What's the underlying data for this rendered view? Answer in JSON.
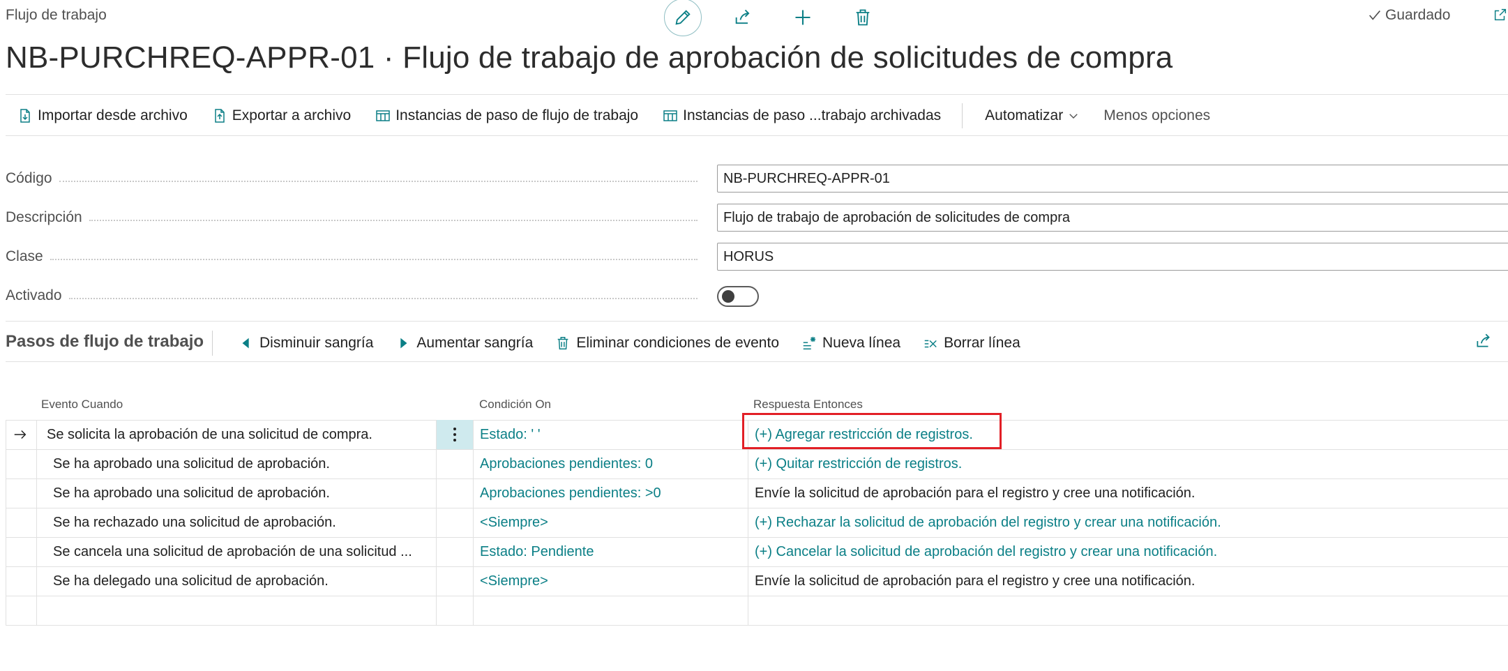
{
  "header": {
    "breadcrumb": "Flujo de trabajo",
    "saved_label": "Guardado",
    "title": "NB-PURCHREQ-APPR-01 · Flujo de trabajo de aprobación de solicitudes de compra",
    "icons": [
      "edit-icon",
      "share-icon",
      "add-icon",
      "delete-icon"
    ]
  },
  "actions": {
    "import": "Importar desde archivo",
    "export": "Exportar a archivo",
    "step_instances": "Instancias de paso de flujo de trabajo",
    "archived_instances": "Instancias de paso ...trabajo archivadas",
    "automate": "Automatizar",
    "fewer_options": "Menos opciones"
  },
  "fields": {
    "code_label": "Código",
    "code_value": "NB-PURCHREQ-APPR-01",
    "description_label": "Descripción",
    "description_value": "Flujo de trabajo de aprobación de solicitudes de compra",
    "class_label": "Clase",
    "class_value": "HORUS",
    "enabled_label": "Activado",
    "enabled": false
  },
  "steps": {
    "title": "Pasos de flujo de trabajo",
    "decrease_indent": "Disminuir sangría",
    "increase_indent": "Aumentar sangría",
    "delete_conditions": "Eliminar condiciones de evento",
    "new_line": "Nueva línea",
    "delete_line": "Borrar línea",
    "columns": {
      "event": "Evento Cuando",
      "condition": "Condición On",
      "response": "Respuesta Entonces"
    },
    "rows": [
      {
        "event": "Se solicita la aprobación de una solicitud de compra.",
        "condition": "Estado: ' '",
        "response": "(+) Agregar restricción de registros.",
        "response_link": true
      },
      {
        "event": "Se ha aprobado una solicitud de aprobación.",
        "condition": "Aprobaciones pendientes: 0",
        "response": "(+) Quitar restricción de registros.",
        "response_link": true
      },
      {
        "event": "Se ha aprobado una solicitud de aprobación.",
        "condition": "Aprobaciones pendientes: >0",
        "response": "Envíe la solicitud de aprobación para el registro y cree una notificación.",
        "response_link": false
      },
      {
        "event": "Se ha rechazado una solicitud de aprobación.",
        "condition": "<Siempre>",
        "response": "(+) Rechazar la solicitud de aprobación del registro y crear una notificación.",
        "response_link": true
      },
      {
        "event": "Se cancela una solicitud de aprobación de una solicitud ...",
        "condition": "Estado: Pendiente",
        "response": "(+) Cancelar la solicitud de aprobación del registro y crear una notificación.",
        "response_link": true
      },
      {
        "event": "Se ha delegado una solicitud de aprobación.",
        "condition": "<Siempre>",
        "response": "Envíe la solicitud de aprobación para el registro y cree una notificación.",
        "response_link": false
      }
    ]
  },
  "colors": {
    "accent": "#0b7f86",
    "highlight_box": "#e21f26",
    "selected_cell": "#cfeaee"
  }
}
